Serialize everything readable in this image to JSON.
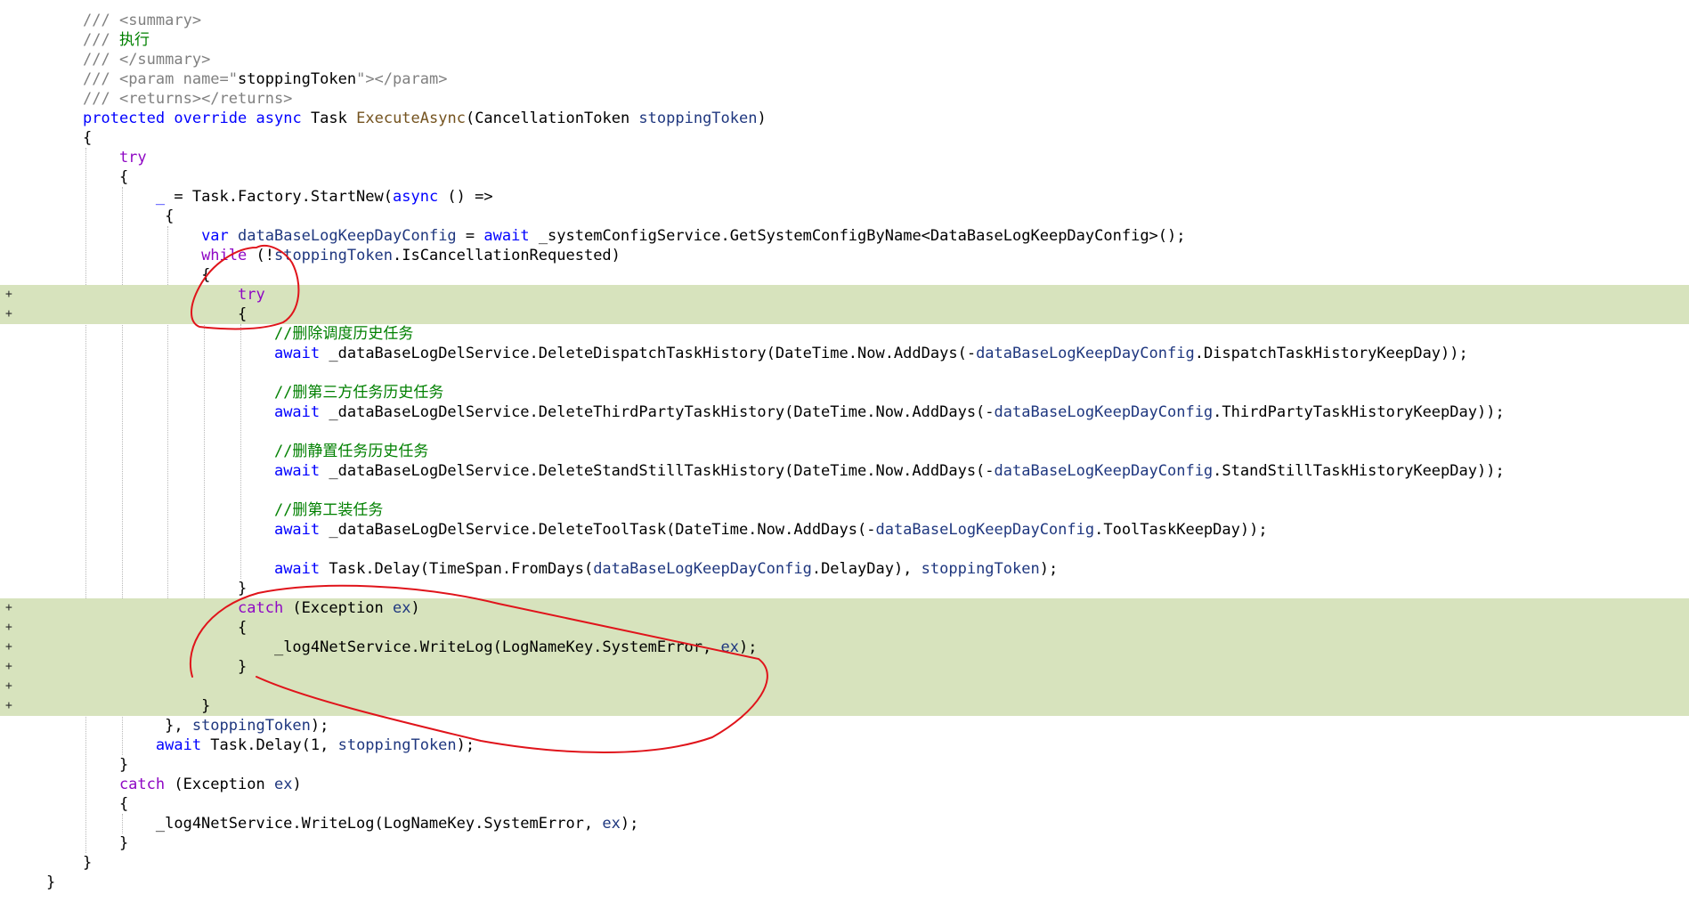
{
  "colors": {
    "keyword": "#0000ff",
    "control": "#8f08c4",
    "comment": "#008000",
    "xmldoc": "#808080",
    "parameter": "#1f377f",
    "method": "#74531f",
    "string": "#a31515",
    "changed_background": "#d7e3bd",
    "annotation_ink": "#e0141b"
  },
  "marker_glyph": "+",
  "lines": [
    {
      "indent": 0,
      "changed": false,
      "tokens": [
        {
          "t": "/// ",
          "c": "xmldoc"
        },
        {
          "t": "<summary>",
          "c": "xmldoc"
        }
      ]
    },
    {
      "indent": 0,
      "changed": false,
      "tokens": [
        {
          "t": "/// ",
          "c": "xmldoc"
        },
        {
          "t": "执行",
          "c": "comment"
        }
      ]
    },
    {
      "indent": 0,
      "changed": false,
      "tokens": [
        {
          "t": "/// ",
          "c": "xmldoc"
        },
        {
          "t": "</summary>",
          "c": "xmldoc"
        }
      ]
    },
    {
      "indent": 0,
      "changed": false,
      "tokens": [
        {
          "t": "/// ",
          "c": "xmldoc"
        },
        {
          "t": "<param name=\"",
          "c": "xmldoc"
        },
        {
          "t": "stoppingToken",
          "c": "plain"
        },
        {
          "t": "\"></param>",
          "c": "xmldoc"
        }
      ]
    },
    {
      "indent": 0,
      "changed": false,
      "tokens": [
        {
          "t": "/// ",
          "c": "xmldoc"
        },
        {
          "t": "<returns></returns>",
          "c": "xmldoc"
        }
      ]
    },
    {
      "indent": 0,
      "changed": false,
      "tokens": [
        {
          "t": "protected",
          "c": "keyword"
        },
        {
          "t": " ",
          "c": "plain"
        },
        {
          "t": "override",
          "c": "keyword"
        },
        {
          "t": " ",
          "c": "plain"
        },
        {
          "t": "async",
          "c": "keyword"
        },
        {
          "t": " Task ",
          "c": "plain"
        },
        {
          "t": "ExecuteAsync",
          "c": "method"
        },
        {
          "t": "(CancellationToken ",
          "c": "plain"
        },
        {
          "t": "stoppingToken",
          "c": "parameter"
        },
        {
          "t": ")",
          "c": "plain"
        }
      ]
    },
    {
      "indent": 0,
      "changed": false,
      "tokens": [
        {
          "t": "{",
          "c": "plain"
        }
      ]
    },
    {
      "indent": 4,
      "changed": false,
      "tokens": [
        {
          "t": "try",
          "c": "control"
        }
      ]
    },
    {
      "indent": 4,
      "changed": false,
      "tokens": [
        {
          "t": "{",
          "c": "plain"
        }
      ]
    },
    {
      "indent": 8,
      "changed": false,
      "tokens": [
        {
          "t": "_",
          "c": "keyword"
        },
        {
          "t": " = Task.Factory.StartNew(",
          "c": "plain"
        },
        {
          "t": "async",
          "c": "keyword"
        },
        {
          "t": " () =>",
          "c": "plain"
        }
      ]
    },
    {
      "indent": 9,
      "changed": false,
      "tokens": [
        {
          "t": "{",
          "c": "plain"
        }
      ]
    },
    {
      "indent": 13,
      "changed": false,
      "tokens": [
        {
          "t": "var",
          "c": "keyword"
        },
        {
          "t": " ",
          "c": "plain"
        },
        {
          "t": "dataBaseLogKeepDayConfig",
          "c": "parameter"
        },
        {
          "t": " = ",
          "c": "plain"
        },
        {
          "t": "await",
          "c": "keyword"
        },
        {
          "t": " _systemConfigService.GetSystemConfigByName<DataBaseLogKeepDayConfig>();",
          "c": "plain"
        }
      ]
    },
    {
      "indent": 13,
      "changed": false,
      "tokens": [
        {
          "t": "while",
          "c": "control"
        },
        {
          "t": " (!",
          "c": "plain"
        },
        {
          "t": "stoppingToken",
          "c": "parameter"
        },
        {
          "t": ".IsCancellationRequested)",
          "c": "plain"
        }
      ]
    },
    {
      "indent": 13,
      "changed": false,
      "tokens": [
        {
          "t": "{",
          "c": "plain"
        }
      ]
    },
    {
      "indent": 17,
      "changed": true,
      "tokens": [
        {
          "t": "try",
          "c": "control"
        }
      ]
    },
    {
      "indent": 17,
      "changed": true,
      "tokens": [
        {
          "t": "{",
          "c": "plain"
        }
      ]
    },
    {
      "indent": 21,
      "changed": false,
      "tokens": [
        {
          "t": "//删除调度历史任务",
          "c": "comment"
        }
      ]
    },
    {
      "indent": 21,
      "changed": false,
      "tokens": [
        {
          "t": "await",
          "c": "keyword"
        },
        {
          "t": " _dataBaseLogDelService.DeleteDispatchTaskHistory(DateTime.Now.AddDays(-",
          "c": "plain"
        },
        {
          "t": "dataBaseLogKeepDayConfig",
          "c": "parameter"
        },
        {
          "t": ".DispatchTaskHistoryKeepDay));",
          "c": "plain"
        }
      ]
    },
    {
      "indent": 21,
      "changed": false,
      "tokens": []
    },
    {
      "indent": 21,
      "changed": false,
      "tokens": [
        {
          "t": "//删第三方任务历史任务",
          "c": "comment"
        }
      ]
    },
    {
      "indent": 21,
      "changed": false,
      "tokens": [
        {
          "t": "await",
          "c": "keyword"
        },
        {
          "t": " _dataBaseLogDelService.DeleteThirdPartyTaskHistory(DateTime.Now.AddDays(-",
          "c": "plain"
        },
        {
          "t": "dataBaseLogKeepDayConfig",
          "c": "parameter"
        },
        {
          "t": ".ThirdPartyTaskHistoryKeepDay));",
          "c": "plain"
        }
      ]
    },
    {
      "indent": 21,
      "changed": false,
      "tokens": []
    },
    {
      "indent": 21,
      "changed": false,
      "tokens": [
        {
          "t": "//删静置任务历史任务",
          "c": "comment"
        }
      ]
    },
    {
      "indent": 21,
      "changed": false,
      "tokens": [
        {
          "t": "await",
          "c": "keyword"
        },
        {
          "t": " _dataBaseLogDelService.DeleteStandStillTaskHistory(DateTime.Now.AddDays(-",
          "c": "plain"
        },
        {
          "t": "dataBaseLogKeepDayConfig",
          "c": "parameter"
        },
        {
          "t": ".StandStillTaskHistoryKeepDay));",
          "c": "plain"
        }
      ]
    },
    {
      "indent": 21,
      "changed": false,
      "tokens": []
    },
    {
      "indent": 21,
      "changed": false,
      "tokens": [
        {
          "t": "//删第工装任务",
          "c": "comment"
        }
      ]
    },
    {
      "indent": 21,
      "changed": false,
      "tokens": [
        {
          "t": "await",
          "c": "keyword"
        },
        {
          "t": " _dataBaseLogDelService.DeleteToolTask(DateTime.Now.AddDays(-",
          "c": "plain"
        },
        {
          "t": "dataBaseLogKeepDayConfig",
          "c": "parameter"
        },
        {
          "t": ".ToolTaskKeepDay));",
          "c": "plain"
        }
      ]
    },
    {
      "indent": 21,
      "changed": false,
      "tokens": []
    },
    {
      "indent": 21,
      "changed": false,
      "tokens": [
        {
          "t": "await",
          "c": "keyword"
        },
        {
          "t": " Task.Delay(TimeSpan.FromDays(",
          "c": "plain"
        },
        {
          "t": "dataBaseLogKeepDayConfig",
          "c": "parameter"
        },
        {
          "t": ".DelayDay), ",
          "c": "plain"
        },
        {
          "t": "stoppingToken",
          "c": "parameter"
        },
        {
          "t": ");",
          "c": "plain"
        }
      ]
    },
    {
      "indent": 17,
      "changed": false,
      "tokens": [
        {
          "t": "}",
          "c": "plain"
        }
      ]
    },
    {
      "indent": 17,
      "changed": true,
      "tokens": [
        {
          "t": "catch",
          "c": "control"
        },
        {
          "t": " (Exception ",
          "c": "plain"
        },
        {
          "t": "ex",
          "c": "parameter"
        },
        {
          "t": ")",
          "c": "plain"
        }
      ]
    },
    {
      "indent": 17,
      "changed": true,
      "tokens": [
        {
          "t": "{",
          "c": "plain"
        }
      ]
    },
    {
      "indent": 21,
      "changed": true,
      "tokens": [
        {
          "t": "_log4NetService.WriteLog(LogNameKey.SystemError, ",
          "c": "plain"
        },
        {
          "t": "ex",
          "c": "parameter"
        },
        {
          "t": ");",
          "c": "plain"
        }
      ]
    },
    {
      "indent": 17,
      "changed": true,
      "tokens": [
        {
          "t": "}",
          "c": "plain"
        }
      ]
    },
    {
      "indent": 17,
      "changed": true,
      "tokens": []
    },
    {
      "indent": 13,
      "changed": true,
      "tokens": [
        {
          "t": "}",
          "c": "plain"
        }
      ]
    },
    {
      "indent": 9,
      "changed": false,
      "tokens": [
        {
          "t": "}, ",
          "c": "plain"
        },
        {
          "t": "stoppingToken",
          "c": "parameter"
        },
        {
          "t": ");",
          "c": "plain"
        }
      ]
    },
    {
      "indent": 8,
      "changed": false,
      "tokens": [
        {
          "t": "await",
          "c": "keyword"
        },
        {
          "t": " Task.Delay(1, ",
          "c": "plain"
        },
        {
          "t": "stoppingToken",
          "c": "parameter"
        },
        {
          "t": ");",
          "c": "plain"
        }
      ]
    },
    {
      "indent": 4,
      "changed": false,
      "tokens": [
        {
          "t": "}",
          "c": "plain"
        }
      ]
    },
    {
      "indent": 4,
      "changed": false,
      "tokens": [
        {
          "t": "catch",
          "c": "control"
        },
        {
          "t": " (Exception ",
          "c": "plain"
        },
        {
          "t": "ex",
          "c": "parameter"
        },
        {
          "t": ")",
          "c": "plain"
        }
      ]
    },
    {
      "indent": 4,
      "changed": false,
      "tokens": [
        {
          "t": "{",
          "c": "plain"
        }
      ]
    },
    {
      "indent": 8,
      "changed": false,
      "tokens": [
        {
          "t": "_log4NetService.WriteLog(LogNameKey.SystemError, ",
          "c": "plain"
        },
        {
          "t": "ex",
          "c": "parameter"
        },
        {
          "t": ");",
          "c": "plain"
        }
      ]
    },
    {
      "indent": 4,
      "changed": false,
      "tokens": [
        {
          "t": "}",
          "c": "plain"
        }
      ]
    },
    {
      "indent": 0,
      "changed": false,
      "tokens": [
        {
          "t": "}",
          "c": "plain"
        }
      ]
    },
    {
      "indent": -4,
      "changed": false,
      "tokens": [
        {
          "t": "}",
          "c": "plain"
        }
      ]
    }
  ]
}
